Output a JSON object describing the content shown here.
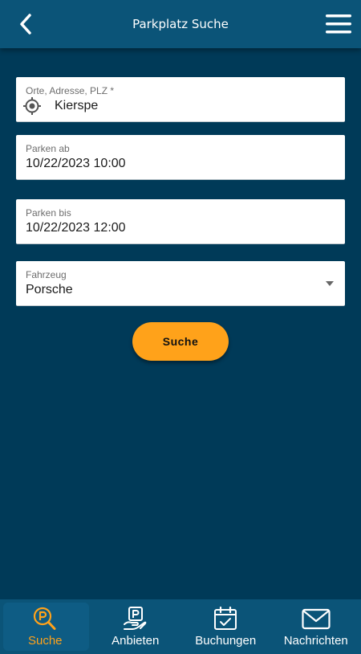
{
  "header": {
    "title": "Parkplatz Suche",
    "back_icon": "chevron-left-icon",
    "menu_icon": "hamburger-menu-icon"
  },
  "form": {
    "location": {
      "label": "Orte, Adresse, PLZ *",
      "value": "Kierspe",
      "icon": "location-crosshair-icon"
    },
    "park_from": {
      "label": "Parken ab",
      "value": "10/22/2023 10:00"
    },
    "park_until": {
      "label": "Parken bis",
      "value": "10/22/2023 12:00"
    },
    "vehicle": {
      "label": "Fahrzeug",
      "value": "Porsche"
    },
    "search_button": "Suche"
  },
  "bottom_nav": {
    "items": [
      {
        "label": "Suche",
        "icon": "parking-search-icon",
        "active": true
      },
      {
        "label": "Anbieten",
        "icon": "parking-offer-icon",
        "active": false
      },
      {
        "label": "Buchungen",
        "icon": "calendar-check-icon",
        "active": false
      },
      {
        "label": "Nachrichten",
        "icon": "envelope-icon",
        "active": false
      }
    ]
  },
  "colors": {
    "background": "#003a58",
    "bar": "#0b5478",
    "accent": "#ffa21a"
  }
}
